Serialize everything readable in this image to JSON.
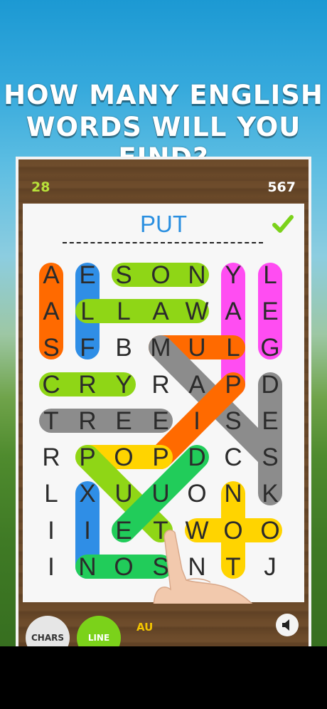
{
  "headline": {
    "line1": "HOW MANY ENGLISH",
    "line2": "WORDS WILL YOU FIND?"
  },
  "scores": {
    "left": "28",
    "right": "567"
  },
  "target_word": "PUT",
  "grid": [
    [
      "A",
      "E",
      "S",
      "O",
      "N",
      "Y",
      "L"
    ],
    [
      "A",
      "L",
      "L",
      "A",
      "W",
      "A",
      "E"
    ],
    [
      "S",
      "F",
      "B",
      "M",
      "U",
      "L",
      "G"
    ],
    [
      "C",
      "R",
      "Y",
      "R",
      "A",
      "P",
      "D"
    ],
    [
      "T",
      "R",
      "E",
      "E",
      "I",
      "S",
      "E"
    ],
    [
      "R",
      "P",
      "O",
      "P",
      "D",
      "C",
      "S"
    ],
    [
      "L",
      "X",
      "U",
      "U",
      "O",
      "N",
      "K"
    ],
    [
      "I",
      "I",
      "E",
      "T",
      "W",
      "O",
      "O"
    ],
    [
      "I",
      "N",
      "O",
      "S",
      "N",
      "T",
      "J"
    ]
  ],
  "highlights": [
    {
      "color": "#ff6a00",
      "from": [
        0,
        0
      ],
      "to": [
        2,
        0
      ]
    },
    {
      "color": "#2f8ee6",
      "from": [
        0,
        1
      ],
      "to": [
        2,
        1
      ]
    },
    {
      "color": "#8fd616",
      "from": [
        0,
        2
      ],
      "to": [
        0,
        4
      ]
    },
    {
      "color": "#ff4df2",
      "from": [
        0,
        5
      ],
      "to": [
        3,
        5
      ]
    },
    {
      "color": "#ff4df2",
      "from": [
        0,
        6
      ],
      "to": [
        2,
        6
      ]
    },
    {
      "color": "#8fd616",
      "from": [
        1,
        1
      ],
      "to": [
        1,
        4
      ]
    },
    {
      "color": "#ff6a00",
      "from": [
        2,
        3
      ],
      "to": [
        2,
        5
      ]
    },
    {
      "color": "#8c8c8c",
      "from": [
        2,
        3
      ],
      "to": [
        5,
        6
      ]
    },
    {
      "color": "#8c8c8c",
      "from": [
        3,
        6
      ],
      "to": [
        6,
        6
      ]
    },
    {
      "color": "#8fd616",
      "from": [
        3,
        0
      ],
      "to": [
        3,
        2
      ]
    },
    {
      "color": "#ff6a00",
      "from": [
        3,
        5
      ],
      "to": [
        5,
        3
      ]
    },
    {
      "color": "#8c8c8c",
      "from": [
        4,
        0
      ],
      "to": [
        4,
        3
      ]
    },
    {
      "color": "#ffd400",
      "from": [
        5,
        1
      ],
      "to": [
        5,
        3
      ]
    },
    {
      "color": "#8fd616",
      "from": [
        5,
        1
      ],
      "to": [
        7,
        3
      ]
    },
    {
      "color": "#21cc5a",
      "from": [
        5,
        4
      ],
      "to": [
        7,
        2
      ]
    },
    {
      "color": "#2f8ee6",
      "from": [
        6,
        1
      ],
      "to": [
        8,
        1
      ]
    },
    {
      "color": "#21cc5a",
      "from": [
        8,
        1
      ],
      "to": [
        8,
        3
      ]
    },
    {
      "color": "#ffd400",
      "from": [
        6,
        5
      ],
      "to": [
        8,
        5
      ]
    },
    {
      "color": "#ffd400",
      "from": [
        7,
        4
      ],
      "to": [
        7,
        6
      ]
    }
  ],
  "buttons": {
    "chars": "CHARS",
    "line": "LINE",
    "auto": "AU"
  },
  "colors": {
    "target": "#2a8fe0",
    "check": "#7bd21a",
    "score_left": "#b8e23a"
  },
  "icons": {
    "check": "check-icon",
    "sound": "speaker-icon",
    "hand": "pointing-hand"
  }
}
